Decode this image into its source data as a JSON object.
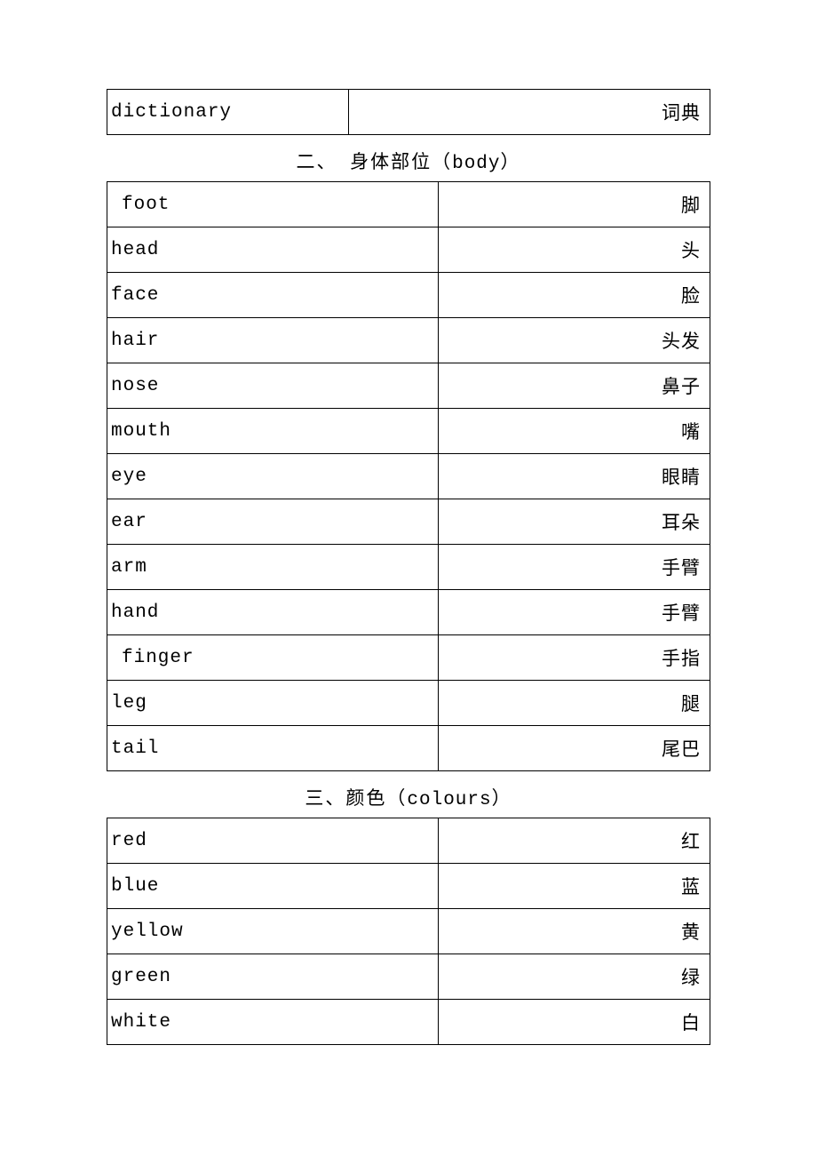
{
  "top_row": {
    "en": "dictionary",
    "cn": "词典"
  },
  "section_body": {
    "heading_prefix": "二、 身体部位（",
    "heading_mono": "body",
    "heading_suffix": "）",
    "rows": [
      {
        "en": " foot",
        "cn": "脚"
      },
      {
        "en": "head",
        "cn": "头"
      },
      {
        "en": "face",
        "cn": "脸"
      },
      {
        "en": "hair",
        "cn": "头发"
      },
      {
        "en": "nose",
        "cn": "鼻子"
      },
      {
        "en": "mouth",
        "cn": "嘴"
      },
      {
        "en": "eye",
        "cn": "眼睛"
      },
      {
        "en": "ear",
        "cn": "耳朵"
      },
      {
        "en": "arm",
        "cn": "手臂"
      },
      {
        "en": "hand",
        "cn": "手臂"
      },
      {
        "en": " finger",
        "cn": "手指"
      },
      {
        "en": "leg",
        "cn": "腿"
      },
      {
        "en": "tail",
        "cn": "尾巴"
      }
    ]
  },
  "section_colours": {
    "heading_prefix": "三、颜色（",
    "heading_mono": "colours",
    "heading_suffix": "）",
    "rows": [
      {
        "en": "red",
        "cn": "红"
      },
      {
        "en": "blue",
        "cn": "蓝"
      },
      {
        "en": "yellow",
        "cn": "黄"
      },
      {
        "en": "green",
        "cn": "绿"
      },
      {
        "en": "white",
        "cn": "白"
      }
    ]
  }
}
